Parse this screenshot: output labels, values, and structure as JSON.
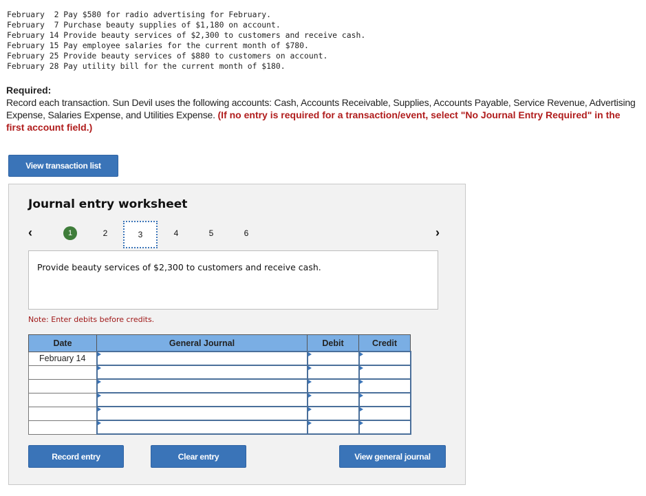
{
  "transactions": [
    {
      "month": "February",
      "day": "2",
      "text": "Pay $580 for radio advertising for February."
    },
    {
      "month": "February",
      "day": "7",
      "text": "Purchase beauty supplies of $1,180 on account."
    },
    {
      "month": "February",
      "day": "14",
      "text": "Provide beauty services of $2,300 to customers and receive cash."
    },
    {
      "month": "February",
      "day": "15",
      "text": "Pay employee salaries for the current month of $780."
    },
    {
      "month": "February",
      "day": "25",
      "text": "Provide beauty services of $880 to customers on account."
    },
    {
      "month": "February",
      "day": "28",
      "text": "Pay utility bill for the current month of $180."
    }
  ],
  "required": {
    "title": "Required:",
    "body": "Record each transaction. Sun Devil uses the following accounts: Cash, Accounts Receivable, Supplies, Accounts Payable, Service Revenue, Advertising Expense, Salaries Expense, and Utilities Expense. ",
    "instruction": "(If no entry is required for a transaction/event, select \"No Journal Entry Required\" in the first account field.)"
  },
  "buttons": {
    "view_transaction_list": "View transaction list",
    "record_entry": "Record entry",
    "clear_entry": "Clear entry",
    "view_general_journal": "View general journal"
  },
  "worksheet": {
    "title": "Journal entry worksheet",
    "prev_icon": "‹",
    "next_icon": "›",
    "steps": [
      "1",
      "2",
      "3",
      "4",
      "5",
      "6"
    ],
    "completed_step": "1",
    "active_step": "3",
    "description": "Provide beauty services of $2,300 to customers and receive cash.",
    "note": "Note: Enter debits before credits.",
    "columns": [
      "Date",
      "General Journal",
      "Debit",
      "Credit"
    ],
    "rows": [
      {
        "date": "February 14",
        "account": "",
        "debit": "",
        "credit": ""
      },
      {
        "date": "",
        "account": "",
        "debit": "",
        "credit": ""
      },
      {
        "date": "",
        "account": "",
        "debit": "",
        "credit": ""
      },
      {
        "date": "",
        "account": "",
        "debit": "",
        "credit": ""
      },
      {
        "date": "",
        "account": "",
        "debit": "",
        "credit": ""
      },
      {
        "date": "",
        "account": "",
        "debit": "",
        "credit": ""
      }
    ]
  }
}
